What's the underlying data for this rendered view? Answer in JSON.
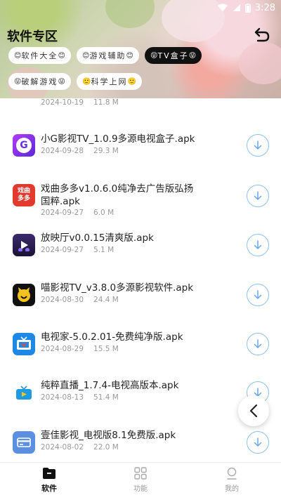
{
  "status_bar": {
    "time": "3:28"
  },
  "header": {
    "title": "软件专区",
    "chips": [
      {
        "emoji_left": "😊",
        "label": "软件大全",
        "emoji_right": "😊",
        "active": false
      },
      {
        "emoji_left": "😊",
        "label": "游戏辅助",
        "emoji_right": "😊",
        "active": false
      },
      {
        "emoji_left": "😝",
        "label": "TV盒子",
        "emoji_right": "😝",
        "active": true
      },
      {
        "emoji_left": "😝",
        "label": "破解游戏",
        "emoji_right": "😝",
        "active": false
      },
      {
        "emoji_left": "🙂",
        "label": "科学上网",
        "emoji_right": "🙂",
        "active": false
      }
    ]
  },
  "apps": [
    {
      "name": "",
      "date": "2024-10-19",
      "size": "11.8 M",
      "icon": "yellow-crown-icon",
      "color": "#1a1a1a"
    },
    {
      "name": "小G影视TV_1.0.9多源电视盒子.apk",
      "date": "2024-09-28",
      "size": "29.3 M",
      "icon": "letter-g-icon",
      "color": "#7a3cf0"
    },
    {
      "name": "戏曲多多v1.0.6.0纯净去广告版弘扬国粹.apk",
      "date": "2024-09-27",
      "size": "6.0 M",
      "icon": "opera-text-icon",
      "color": "#e23a2e",
      "icon_text_1": "戏曲",
      "icon_text_2": "多多"
    },
    {
      "name": "放映厅v0.0.15清爽版.apk",
      "date": "2024-09-27",
      "size": "5.1 M",
      "icon": "play-cinema-icon",
      "color": "#2a1d4d"
    },
    {
      "name": "喵影视TV_v3.8.0多源影视软件.apk",
      "date": "2024-08-30",
      "size": "24.4 M",
      "icon": "cat-face-icon",
      "color": "#111111"
    },
    {
      "name": "电视家-5.0.2.01-免费纯净版.apk",
      "date": "2024-08-29",
      "size": "15.5 M",
      "icon": "tv-house-icon",
      "color": "#1e88e5"
    },
    {
      "name": "纯粹直播_1.7.4-电视高版本.apk",
      "date": "2024-08-13",
      "size": "51.4 M",
      "icon": "tv-play-icon",
      "color": "#ffffff"
    },
    {
      "name": "壹佳影视_电视版8.1免费版.apk",
      "date": "2024-08-02",
      "size": "22.0 M",
      "icon": "card-icon",
      "color": "#5b8fe0"
    }
  ],
  "bottom_nav": [
    {
      "label": "软件",
      "icon": "folder-icon",
      "active": true
    },
    {
      "label": "功能",
      "icon": "grid-icon",
      "active": false
    },
    {
      "label": "我的",
      "icon": "user-icon",
      "active": false
    }
  ]
}
